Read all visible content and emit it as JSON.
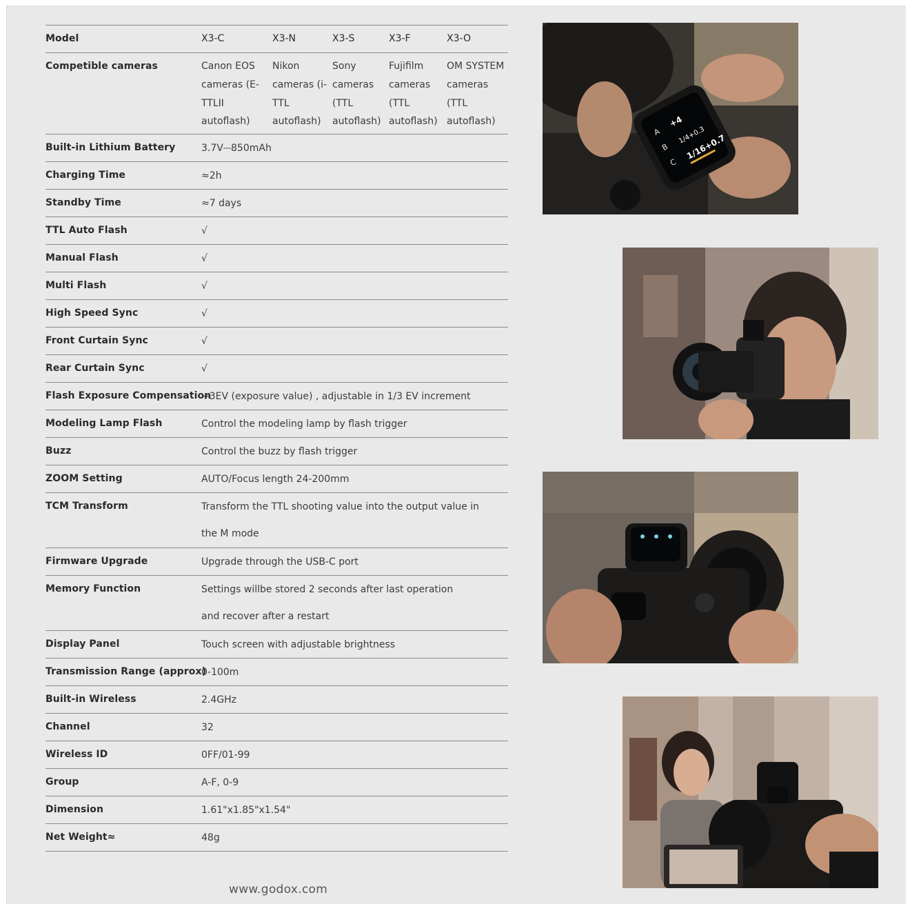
{
  "table": {
    "header": {
      "label": "Model",
      "models": [
        "X3-C",
        "X3-N",
        "X3-S",
        "X3-F",
        "X3-O"
      ]
    },
    "compatible": {
      "label": "Competible cameras",
      "values": [
        "Canon EOS cameras (E-TTLII autoflash)",
        "Nikon cameras (i-TTL autoflash)",
        "Sony cameras (TTL autoflash)",
        "Fujifilm cameras (TTL autoflash)",
        "OM SYSTEM cameras (TTL autoflash)"
      ]
    },
    "rows": [
      {
        "label": "Built-in Lithium Battery",
        "value": "3.7V⎓850mAh"
      },
      {
        "label": "Charging Time",
        "value": "≈2h"
      },
      {
        "label": "Standby Time",
        "value": "≈7 days"
      },
      {
        "label": "TTL Auto Flash",
        "value": "√"
      },
      {
        "label": "Manual Flash",
        "value": "√"
      },
      {
        "label": "Multi Flash",
        "value": "√"
      },
      {
        "label": "High Speed Sync",
        "value": "√"
      },
      {
        "label": "Front Curtain Sync",
        "value": "√"
      },
      {
        "label": "Rear Curtain Sync",
        "value": "√"
      },
      {
        "label": "Flash Exposure Compensation",
        "value": "+3EV (exposure value) , adjustable in 1/3 EV increment"
      },
      {
        "label": "Modeling Lamp Flash",
        "value": "Control the modeling lamp by flash trigger"
      },
      {
        "label": "Buzz",
        "value": "Control the buzz by flash trigger"
      },
      {
        "label": "ZOOM Setting",
        "value": "AUTO/Focus length 24-200mm"
      },
      {
        "label": "TCM Transform",
        "value": "Transform the TTL shooting value into the output value in the M mode"
      },
      {
        "label": "Firmware Upgrade",
        "value": "Upgrade through the USB-C port"
      },
      {
        "label": "Memory Function",
        "value": "Settings willbe stored 2 seconds after last operation and recover after a restart"
      },
      {
        "label": "Display Panel",
        "value": "Touch screen with adjustable brightness"
      },
      {
        "label": "Transmission Range (approx)",
        "value": "0-100m"
      },
      {
        "label": "Built-in Wireless",
        "value": "2.4GHz"
      },
      {
        "label": "Channel",
        "value": "32"
      },
      {
        "label": "Wireless ID",
        "value": "0FF/01-99"
      },
      {
        "label": "Group",
        "value": "A-F, 0-9"
      },
      {
        "label": "Dimension",
        "value": "1.61\"x1.85\"x1.54\""
      },
      {
        "label": "Net Weight≈",
        "value": "48g"
      }
    ]
  },
  "footer": {
    "website": "www.godox.com"
  },
  "photos": [
    {
      "name": "photo-hands-trigger-screen"
    },
    {
      "name": "photo-man-shooting-camera"
    },
    {
      "name": "photo-trigger-on-camera"
    },
    {
      "name": "photo-woman-street-shoot"
    }
  ]
}
